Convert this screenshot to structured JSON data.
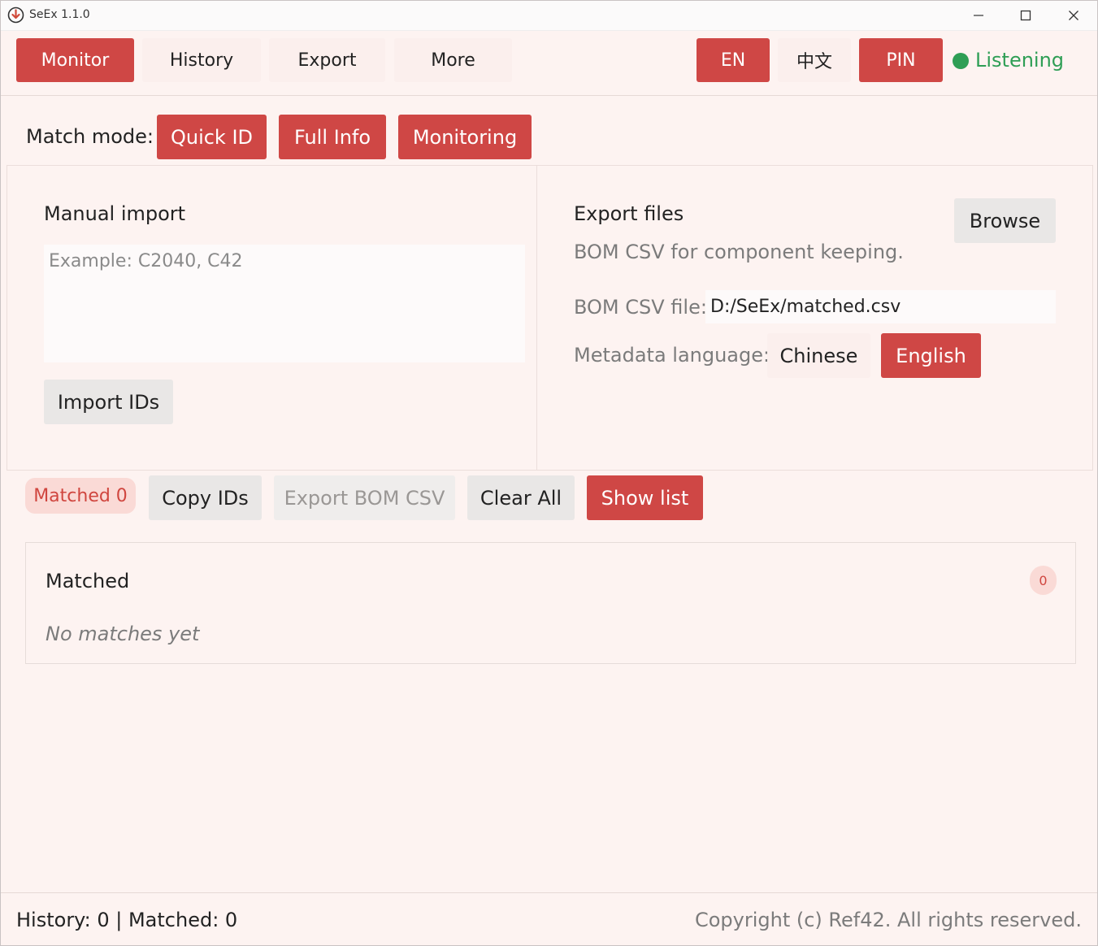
{
  "window": {
    "title": "SeEx 1.1.0"
  },
  "nav": {
    "tabs": [
      "Monitor",
      "History",
      "Export",
      "More"
    ],
    "lang_en": "EN",
    "lang_zh": "中文",
    "pin": "PIN",
    "status": "Listening",
    "status_color": "#2e9e55"
  },
  "match_mode": {
    "label": "Match mode:",
    "options": [
      "Quick ID",
      "Full Info",
      "Monitoring"
    ]
  },
  "manual_import": {
    "title": "Manual import",
    "placeholder": "Example: C2040, C42",
    "import_button": "Import IDs"
  },
  "export_files": {
    "title": "Export files",
    "browse_button": "Browse",
    "description": "BOM CSV for component keeping.",
    "bom_label": "BOM CSV file:",
    "bom_value": "D:/SeEx/matched.csv",
    "metadata_label": "Metadata language:",
    "metadata_options": [
      "Chinese",
      "English"
    ]
  },
  "actions": {
    "matched_badge": "Matched 0",
    "copy_ids": "Copy IDs",
    "export_bom": "Export BOM CSV",
    "clear_all": "Clear All",
    "show_list": "Show list"
  },
  "matched_list": {
    "title": "Matched",
    "count": "0",
    "empty_text": "No matches yet"
  },
  "footer": {
    "stats": "History: 0 | Matched: 0",
    "copyright": "Copyright (c) Ref42. All rights reserved."
  },
  "colors": {
    "accent": "#cf4745",
    "background": "#fdf3f1"
  }
}
